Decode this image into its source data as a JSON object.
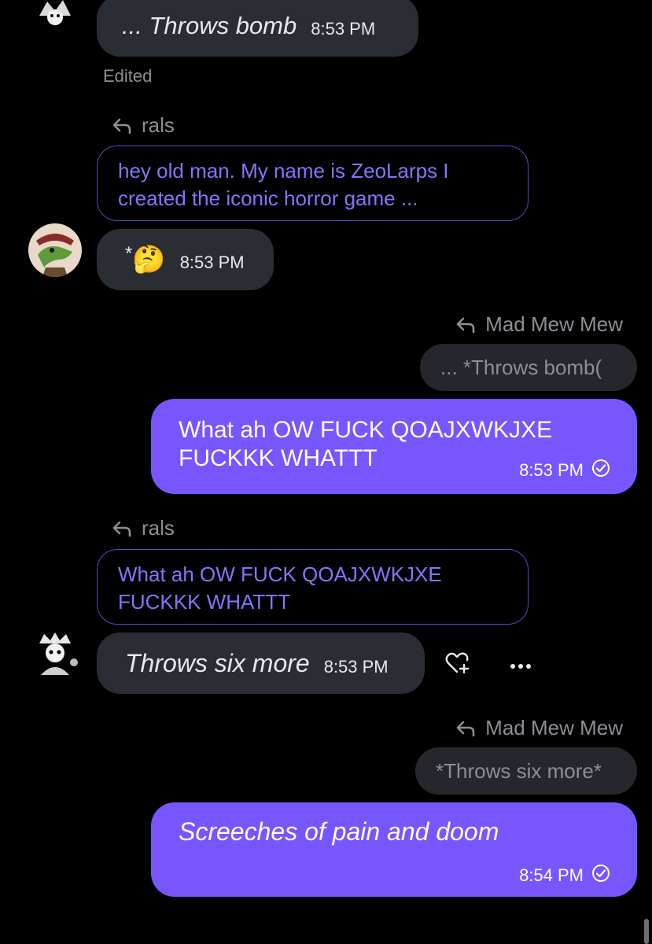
{
  "messages": {
    "m1": {
      "text": "... Throws bomb",
      "time": "8:53 PM",
      "edited": "Edited"
    },
    "q1": {
      "reply_to": "rals",
      "quote": "hey old man. My name is ZeoLarps I created the iconic horror game ..."
    },
    "m2": {
      "text": "*",
      "emoji": "🤔",
      "time": "8:53 PM"
    },
    "q2": {
      "reply_to": "Mad Mew Mew",
      "quote": "... *Throws bomb("
    },
    "m3": {
      "line1": "What ah OW FUCK QOAJXWKJXE",
      "line2": "FUCKKK WHATTT",
      "time": "8:53 PM"
    },
    "q3": {
      "reply_to": "rals",
      "line1": "What ah OW FUCK QOAJXWKJXE",
      "line2": "FUCKKK WHATTT"
    },
    "m4": {
      "text": "Throws six more",
      "time": "8:53 PM"
    },
    "q4": {
      "reply_to": "Mad Mew Mew",
      "quote": "*Throws six more*"
    },
    "m5": {
      "text": "Screeches of pain and doom",
      "time": "8:54 PM"
    }
  },
  "icons": {
    "reply": "reply-arrow-icon",
    "react": "add-reaction-heart-icon",
    "more": "more-dots-icon",
    "read": "read-check-icon"
  },
  "colors": {
    "background": "#000000",
    "bubble_dark": "#2a2d33",
    "bubble_purple": "#7856ff",
    "quote_text": "#8b71ff",
    "muted": "#8b9096"
  }
}
